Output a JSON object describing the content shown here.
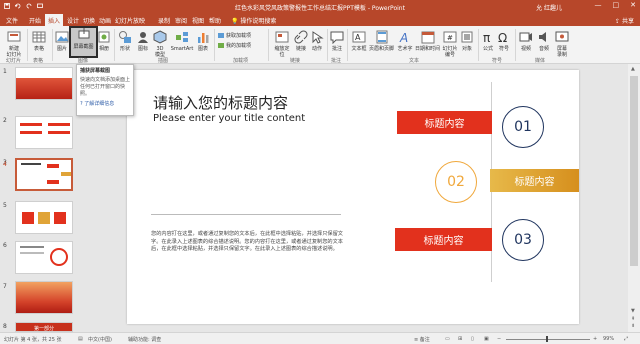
{
  "titlebar": {
    "doc_title": "红色水彩风党风政策警报性工作总结汇报PPT模板 - PowerPoint",
    "user": "允 红趣儿",
    "minimize": "—",
    "restore": "□",
    "close": "✕"
  },
  "tabs": [
    "文件",
    "开始",
    "插入",
    "设计",
    "切换",
    "动画",
    "幻灯片放映",
    "录制",
    "审阅",
    "视图",
    "帮助"
  ],
  "active_tab_index": 2,
  "tell_me": "操作说明搜索",
  "share": "共享",
  "ribbon": {
    "new_slide": "新建\n幻灯片",
    "table": "表格",
    "images": "图片",
    "screenshot": "屏幕截图",
    "album": "相册",
    "shapes": "形状",
    "icons": "图标",
    "models": "3D\n模型",
    "smartart": "SmartArt",
    "chart": "图表",
    "get_addins": "获取加载项",
    "my_addins": "我的加载项",
    "zoom": "缩放定\n位",
    "link": "链接",
    "action": "动作",
    "comment": "批注",
    "textbox": "文本框",
    "header_footer": "页眉和页脚",
    "wordart": "艺术字",
    "datetime": "日期和时间",
    "slide_number": "幻灯片\n编号",
    "object": "对象",
    "equation": "公式",
    "symbol": "符号",
    "video": "视频",
    "audio": "音频",
    "screen_record": "屏幕\n录制",
    "groups": {
      "slides": "幻灯片",
      "tables": "表格",
      "images": "图像",
      "illustrations": "插图",
      "addins": "加载项",
      "links": "链接",
      "comments": "批注",
      "text": "文本",
      "symbols": "符号",
      "media": "媒体"
    }
  },
  "tooltip": {
    "title": "捕获屏幕截图",
    "desc": "快速向文档添加桌面上任何已打开窗口的快照。",
    "link": "了解详细信息"
  },
  "thumbnails": [
    {
      "num": "1",
      "selected": false
    },
    {
      "num": "2",
      "selected": false
    },
    {
      "num": "3",
      "selected": false
    },
    {
      "num": "4",
      "selected": true
    },
    {
      "num": "5",
      "selected": false
    },
    {
      "num": "6",
      "selected": false
    },
    {
      "num": "7",
      "selected": false
    },
    {
      "num": "8",
      "selected": false
    }
  ],
  "thumb_texts": {
    "t3_title": "01",
    "t8_title": "第一部分"
  },
  "slide": {
    "title": "请输入您的标题内容",
    "subtitle": "Please enter your title content",
    "paragraph": "您的内容打在这里，或者通过复制您的文本后，在此框中选择粘贴，并选择只保留文字。在此录入上述图表的综合描述说明。您的内容打在这里，或者通过复制您的文本后，在此框中选择粘贴，并选择只保留文字。在此录入上述图表的综合描述说明。",
    "items": [
      {
        "label": "标题内容",
        "num": "01"
      },
      {
        "label": "标题内容",
        "num": "02"
      },
      {
        "label": "标题内容",
        "num": "03"
      }
    ]
  },
  "status": {
    "slide_pos": "幻灯片 第 4 张，共 25 张",
    "lang": "中文(中国)",
    "accessibility": "辅助功能: 调查",
    "notes": "备注",
    "zoom": "99%"
  },
  "colors": {
    "brand": "#b7472a",
    "red": "#e2311d",
    "gold": "#e0a438",
    "navy": "#20355f"
  }
}
